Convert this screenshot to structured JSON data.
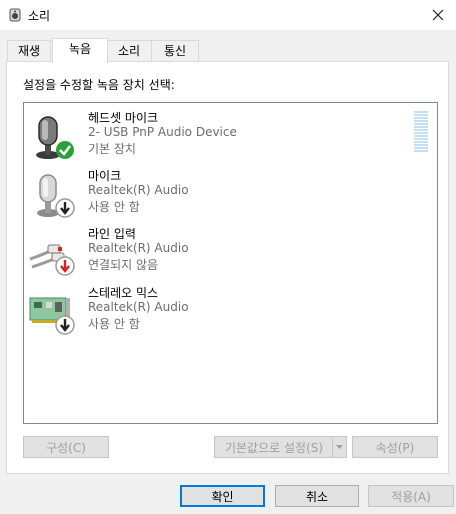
{
  "window": {
    "title": "소리",
    "close_glyph": "✕"
  },
  "tabs": [
    {
      "label": "재생"
    },
    {
      "label": "녹음"
    },
    {
      "label": "소리"
    },
    {
      "label": "통신"
    }
  ],
  "active_tab": "녹음",
  "instruction": "설정을 수정할 녹음 장치 선택:",
  "devices": [
    {
      "name": "헤드셋 마이크",
      "detail": "2- USB PnP Audio Device",
      "status": "기본 장치",
      "icon": "headset-mic-icon",
      "badge": "default-check"
    },
    {
      "name": "마이크",
      "detail": "Realtek(R) Audio",
      "status": "사용 안 함",
      "icon": "microphone-icon",
      "badge": "disabled-down-arrow"
    },
    {
      "name": "라인 입력",
      "detail": "Realtek(R) Audio",
      "status": "연결되지 않음",
      "icon": "line-in-cable-icon",
      "badge": "unplugged-red-arrow"
    },
    {
      "name": "스테레오 믹스",
      "detail": "Realtek(R) Audio",
      "status": "사용 안 함",
      "icon": "sound-card-icon",
      "badge": "disabled-down-arrow"
    }
  ],
  "buttons": {
    "configure": "구성(C)",
    "set_default": "기본값으로 설정(S)",
    "properties": "속성(P)",
    "ok": "확인",
    "cancel": "취소",
    "apply": "적용(A)"
  },
  "colors": {
    "accent": "#0078d7",
    "check_green": "#2e9e3c",
    "down_red": "#d42323"
  }
}
